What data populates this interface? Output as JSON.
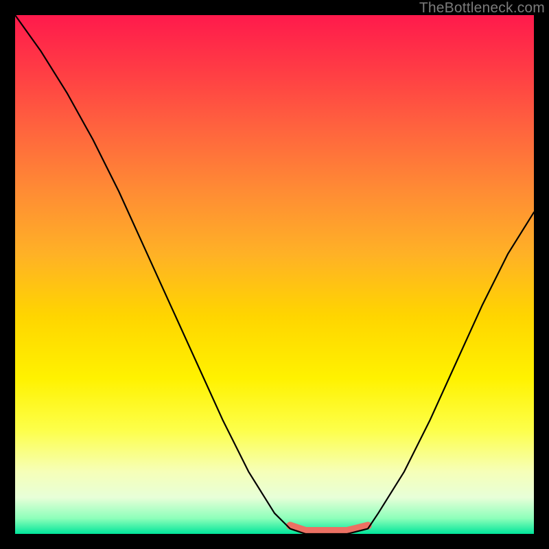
{
  "watermark": "TheBottleneck.com",
  "colors": {
    "background": "#000000",
    "curve": "#000000",
    "plateau_highlight": "#ec7063",
    "gradient_top": "#ff1a4c",
    "gradient_bottom": "#00e59a"
  },
  "chart_data": {
    "type": "line",
    "title": "",
    "xlabel": "",
    "ylabel": "",
    "xlim": [
      0,
      100
    ],
    "ylim": [
      0,
      100
    ],
    "grid": false,
    "legend": false,
    "series": [
      {
        "name": "bottleneck-curve",
        "x": [
          0,
          5,
          10,
          15,
          20,
          25,
          30,
          35,
          40,
          45,
          50,
          53,
          56,
          60,
          64,
          68,
          70,
          75,
          80,
          85,
          90,
          95,
          100
        ],
        "values": [
          100,
          93,
          85,
          76,
          66,
          55,
          44,
          33,
          22,
          12,
          4,
          1,
          0,
          0,
          0,
          1,
          4,
          12,
          22,
          33,
          44,
          54,
          62
        ]
      }
    ],
    "annotations": [
      {
        "name": "valley-plateau",
        "x_range": [
          51,
          68
        ],
        "y": 0,
        "color": "#ec7063"
      }
    ]
  }
}
